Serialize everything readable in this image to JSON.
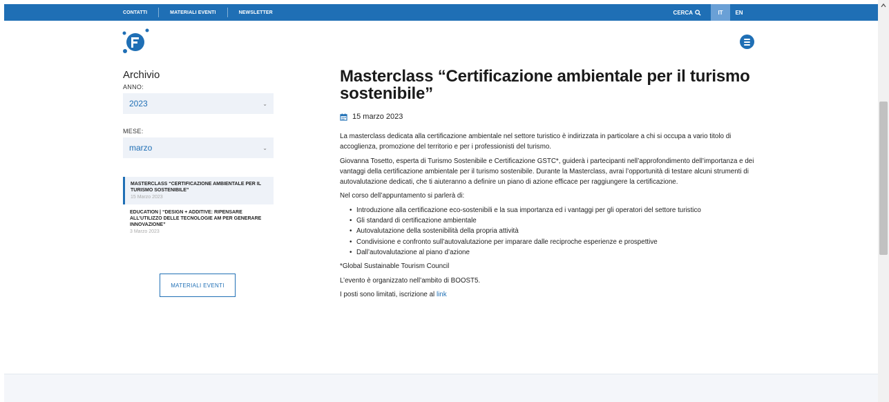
{
  "topbar": {
    "nav": [
      "CONTATTI",
      "MATERIALI EVENTI",
      "NEWSLETTER"
    ],
    "search_label": "CERCA",
    "lang_it": "IT",
    "lang_en": "EN"
  },
  "sidebar": {
    "title": "Archivio",
    "year_label": "ANNO:",
    "year_value": "2023",
    "month_label": "MESE:",
    "month_value": "marzo",
    "articles": [
      {
        "title": "MASTERCLASS “CERTIFICAZIONE AMBIENTALE PER IL TURISMO SOSTENIBILE”",
        "date": "15 Marzo 2023"
      },
      {
        "title": "EDUCATION | “DESIGN + ADDITIVE: RIPENSARE ALL’UTILIZZO DELLE TECNOLOGIE AM PER GENERARE INNOVAZIONE”",
        "date": "3 Marzo 2023"
      }
    ],
    "button_label": "MATERIALI EVENTI"
  },
  "article": {
    "title": "Masterclass “Certificazione ambientale per il turismo sostenibile”",
    "date": "15 marzo 2023",
    "p1": "La masterclass dedicata alla certificazione ambientale nel settore turistico è indirizzata in particolare a chi si occupa a vario titolo di accoglienza, promozione del territorio e per i professionisti del turismo.",
    "p2": "Giovanna Tosetto, esperta di Turismo Sostenibile e Certificazione GSTC*, guiderà i partecipanti nell’approfondimento dell’importanza e dei vantaggi della certificazione ambientale per il turismo sostenibile. Durante la Masterclass, avrai l’opportunità di testare alcuni strumenti di autovalutazione dedicati, che ti aiuteranno a definire un piano di azione efficace per raggiungere la certificazione.",
    "p3": "Nel corso dell’appuntamento si parlerà di:",
    "bullets": [
      "Introduzione alla certificazione eco-sostenibili e la sua importanza ed i vantaggi per gli operatori del settore turistico",
      "Gli standard di certificazione ambientale",
      "Autovalutazione della sostenibilità della propria attività",
      "Condivisione e confronto sull’autovalutazione per imparare dalle reciproche esperienze e prospettive",
      "Dall’autovalutazione al piano d’azione"
    ],
    "p4": "*Global Sustainable Tourism Council",
    "p5": "L’evento è organizzato nell’ambito di BOOST5.",
    "p6": "I posti sono limitati, iscrizione al",
    "link_label": "link"
  },
  "colors": {
    "brand_blue": "#1f6fb5",
    "light_panel": "#eef2f8"
  }
}
